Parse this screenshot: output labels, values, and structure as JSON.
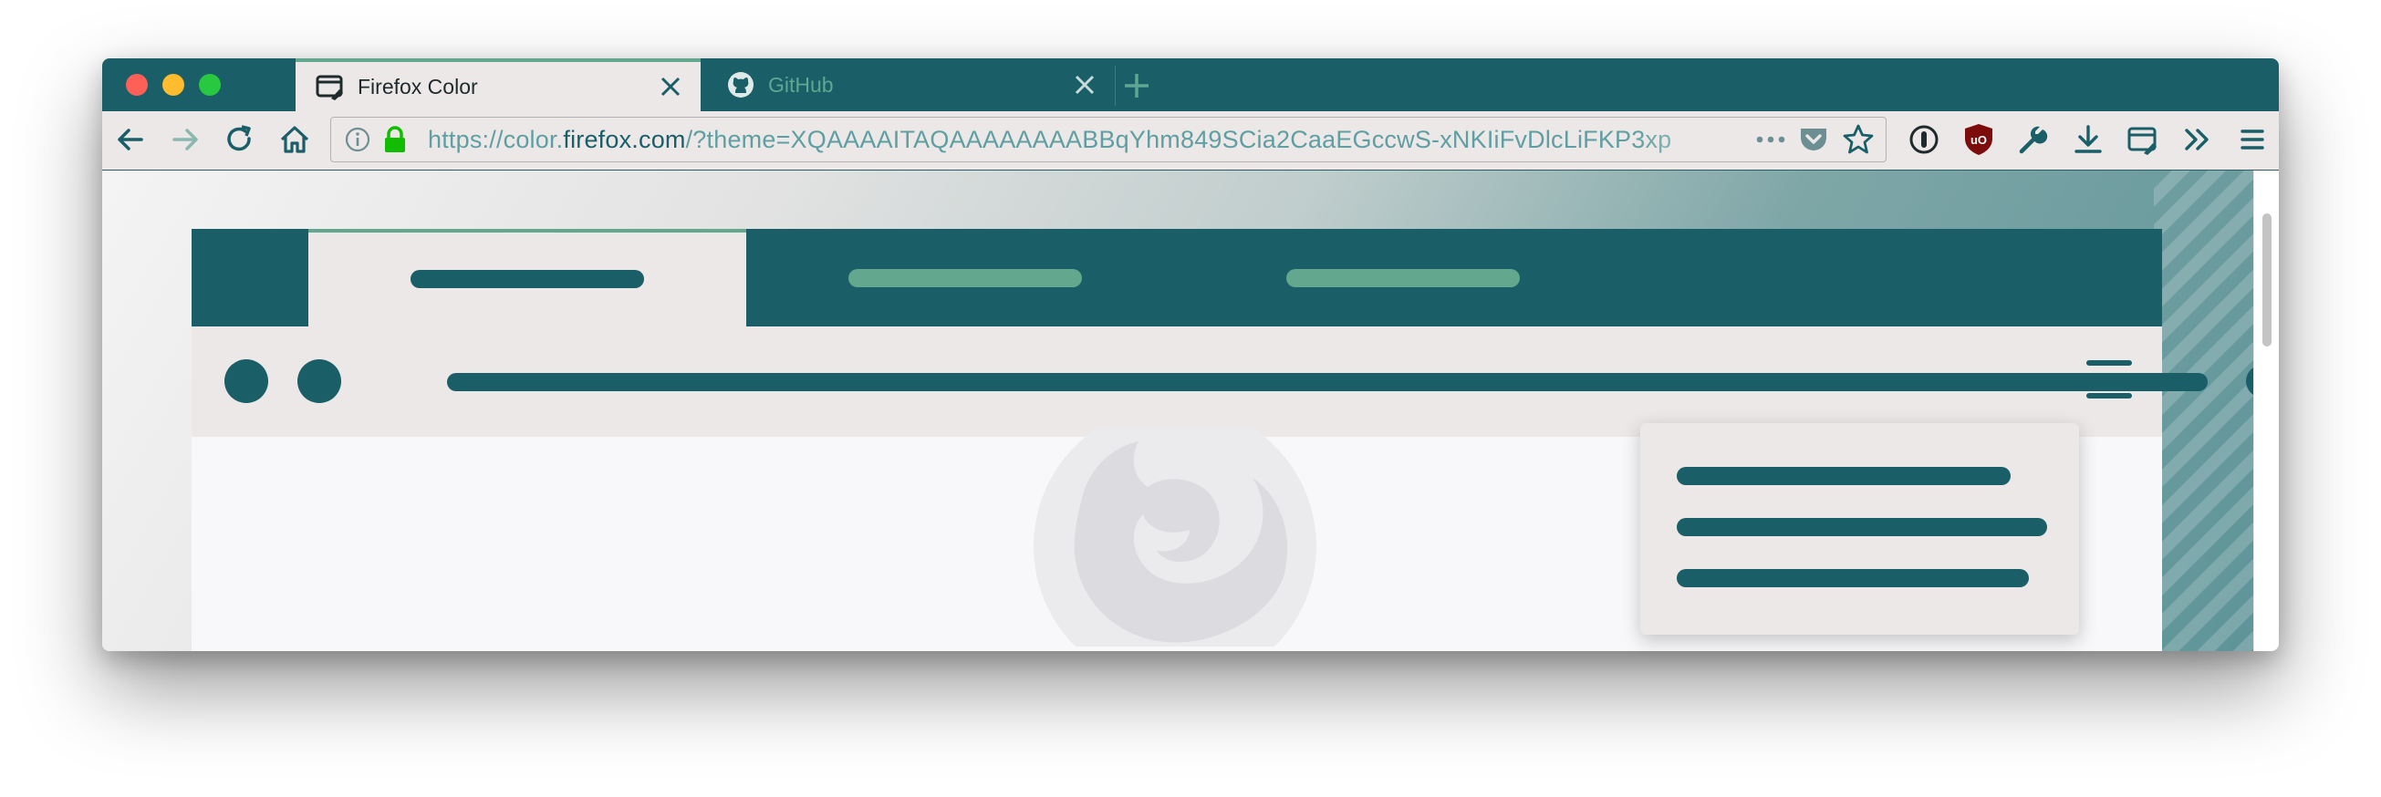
{
  "window": {
    "traffic_lights": {
      "close": "#fe5f57",
      "minimize": "#febc2e",
      "zoom": "#28c840"
    }
  },
  "tabs": [
    {
      "title": "Firefox Color",
      "active": true,
      "icon": "firefox-color-icon"
    },
    {
      "title": "GitHub",
      "active": false,
      "icon": "github-icon"
    }
  ],
  "navbar": {
    "url_prefix": "https://color.",
    "url_host": "firefox.com",
    "url_suffix": "/?theme=XQAAAAITAQAAAAAAAABBqYhm849SCia2CaaEGccwS-xNKIiFvDlcLiFKP3xp",
    "icons": [
      "back-icon",
      "forward-icon",
      "reload-icon",
      "home-icon",
      "info-icon",
      "lock-icon",
      "page-actions-icon",
      "pocket-icon",
      "bookmark-star-icon",
      "password-manager-icon",
      "ublock-origin-icon",
      "tools-icon",
      "downloads-icon",
      "firefox-color-icon",
      "overflow-icon",
      "menu-icon"
    ],
    "ublock_badge": "uO"
  },
  "theme": {
    "frame": "#1a5e67",
    "tab_text": "#5fa792",
    "active_tab_line": "#63a78f",
    "toolbar": "#ece8e8",
    "toolbar_text": "#1a5e67",
    "body": "#f8f8fa"
  }
}
